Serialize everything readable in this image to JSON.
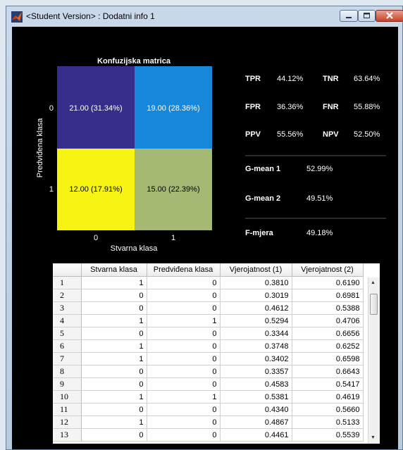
{
  "window": {
    "title": "<Student Version> : Dodatni info 1"
  },
  "matrix": {
    "title": "Konfuzijska matrica",
    "xlabel": "Stvarna klasa",
    "ylabel": "Predviđena klasa",
    "ticks": [
      "0",
      "1"
    ],
    "cells": [
      {
        "label": "21.00 (31.34%)",
        "color": "#362e8a"
      },
      {
        "label": "19.00 (28.36%)",
        "color": "#1787d9"
      },
      {
        "label": "12.00 (17.91%)",
        "color": "#f7f414"
      },
      {
        "label": "15.00 (22.39%)",
        "color": "#a5b874"
      }
    ]
  },
  "metrics": {
    "tpr_label": "TPR",
    "tpr": "44.12%",
    "tnr_label": "TNR",
    "tnr": "63.64%",
    "fpr_label": "FPR",
    "fpr": "36.36%",
    "fnr_label": "FNR",
    "fnr": "55.88%",
    "ppv_label": "PPV",
    "ppv": "55.56%",
    "npv_label": "NPV",
    "npv": "52.50%",
    "gmean1_label": "G-mean 1",
    "gmean1": "52.99%",
    "gmean2_label": "G-mean 2",
    "gmean2": "49.51%",
    "fmjera_label": "F-mjera",
    "fmjera": "49.18%"
  },
  "table": {
    "columns": [
      "Stvarna klasa",
      "Predviđena klasa",
      "Vjerojatnost (1)",
      "Vjerojatnost (2)"
    ],
    "rows": [
      [
        "1",
        "1",
        "0",
        "0.3810",
        "0.6190"
      ],
      [
        "2",
        "0",
        "0",
        "0.3019",
        "0.6981"
      ],
      [
        "3",
        "0",
        "0",
        "0.4612",
        "0.5388"
      ],
      [
        "4",
        "1",
        "1",
        "0.5294",
        "0.4706"
      ],
      [
        "5",
        "0",
        "0",
        "0.3344",
        "0.6656"
      ],
      [
        "6",
        "1",
        "0",
        "0.3748",
        "0.6252"
      ],
      [
        "7",
        "1",
        "0",
        "0.3402",
        "0.6598"
      ],
      [
        "8",
        "0",
        "0",
        "0.3357",
        "0.6643"
      ],
      [
        "9",
        "0",
        "0",
        "0.4583",
        "0.5417"
      ],
      [
        "10",
        "1",
        "1",
        "0.5381",
        "0.4619"
      ],
      [
        "11",
        "0",
        "0",
        "0.4340",
        "0.5660"
      ],
      [
        "12",
        "1",
        "0",
        "0.4867",
        "0.5133"
      ],
      [
        "13",
        "0",
        "0",
        "0.4461",
        "0.5539"
      ]
    ]
  },
  "icons": {
    "app": "matlab-icon",
    "minimize": "minimize-icon",
    "maximize": "maximize-icon",
    "close": "close-icon"
  }
}
